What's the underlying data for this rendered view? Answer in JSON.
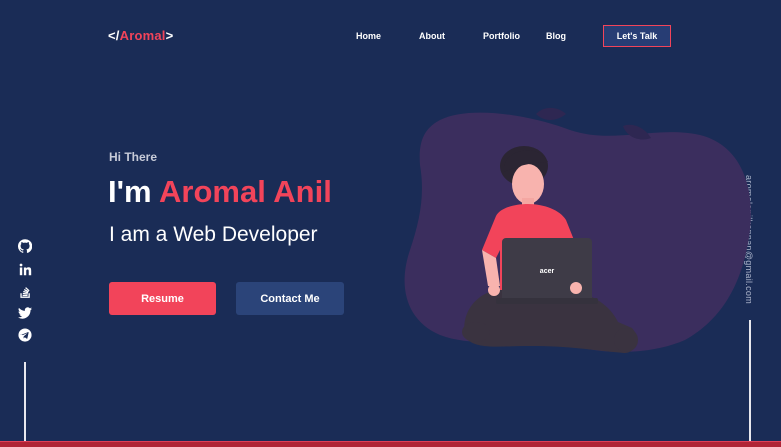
{
  "brand": {
    "open": "</",
    "name": "Aromal",
    "close": ">"
  },
  "nav": {
    "home": "Home",
    "about": "About",
    "portfolio": "Portfolio",
    "blog": "Blog",
    "cta": "Let's Talk"
  },
  "hero": {
    "greeting": "Hi There",
    "headline_prefix": "I'm ",
    "headline_name": "Aromal Anil",
    "role": "I am a Web Developer",
    "resume_label": "Resume",
    "contact_label": "Contact Me"
  },
  "social": [
    "github-icon",
    "linkedin-icon",
    "stackoverflow-icon",
    "twitter-icon",
    "telegram-icon"
  ],
  "email": "aromalanilkannan@gmail.com",
  "laptop_brand": "acer",
  "colors": {
    "background": "#1a2c56",
    "accent": "#f2445a",
    "secondary_button": "#2b4479",
    "blob": "#3b2e5e"
  }
}
